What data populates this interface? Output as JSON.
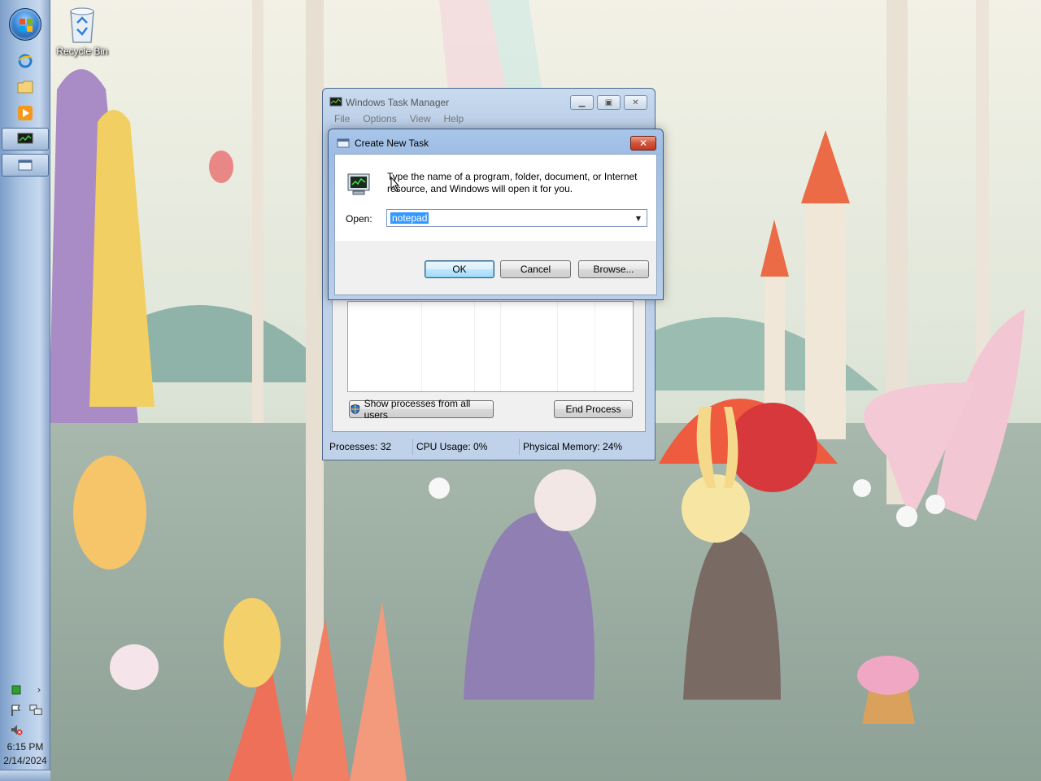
{
  "taskbar": {
    "clock_time": "6:15 PM",
    "clock_date": "2/14/2024"
  },
  "desktop": {
    "icons": [
      {
        "label": "Recycle Bin",
        "icon": "recycle-bin-icon"
      }
    ]
  },
  "task_manager": {
    "title": "Windows Task Manager",
    "menu": [
      "File",
      "Options",
      "View",
      "Help"
    ],
    "show_all_processes_label": "Show processes from all users",
    "end_process_label": "End Process",
    "status": {
      "processes": "Processes: 32",
      "cpu": "CPU Usage: 0%",
      "memory": "Physical Memory: 24%"
    }
  },
  "create_task_dialog": {
    "title": "Create New Task",
    "message": "Type the name of a program, folder, document, or Internet resource, and Windows will open it for you.",
    "open_label": "Open:",
    "open_value": "notepad",
    "ok_label": "OK",
    "cancel_label": "Cancel",
    "browse_label": "Browse..."
  }
}
